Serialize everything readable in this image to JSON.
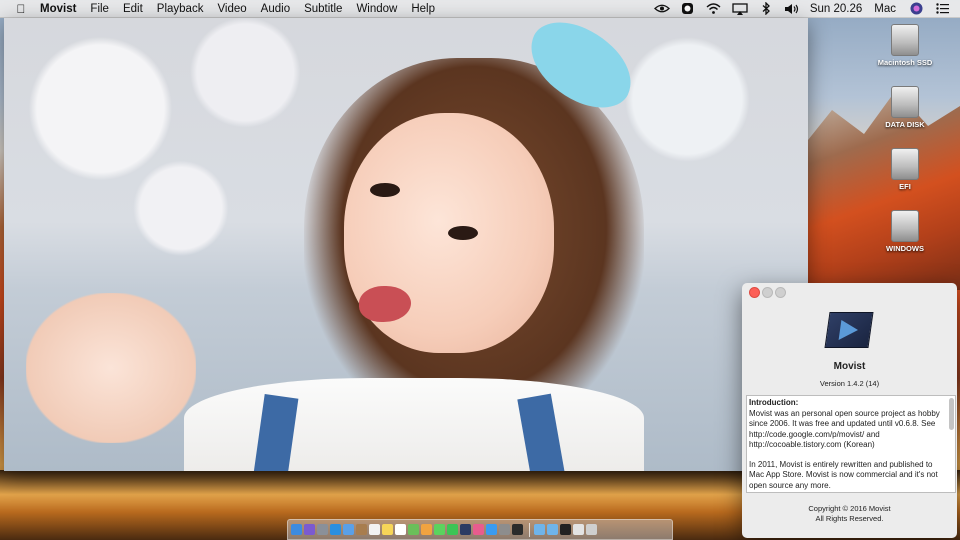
{
  "menubar": {
    "apple_icon": "apple-icon",
    "app_name": "Movist",
    "menus": [
      "File",
      "Edit",
      "Playback",
      "Video",
      "Audio",
      "Subtitle",
      "Window",
      "Help"
    ],
    "status_icons": [
      "nvidia-icon",
      "app-menu-icon",
      "wifi-icon",
      "airplay-icon",
      "bluetooth-icon",
      "volume-icon"
    ],
    "clock": "Sun 20.26",
    "user": "Mac",
    "siri_icon": "siri-icon",
    "notification_icon": "notification-center-icon"
  },
  "desktop": {
    "drives": [
      {
        "label": "Macintosh SSD"
      },
      {
        "label": "DATA DISK"
      },
      {
        "label": "EFI"
      },
      {
        "label": "WINDOWS"
      }
    ]
  },
  "about_window": {
    "title": "Movist",
    "version": "Version 1.4.2 (14)",
    "info_heading": "Introduction:",
    "info_paragraphs": [
      "Movist was an personal open source project as hobby since 2006. It was free and updated until v0.6.8. See http://code.google.com/p/movist/ and http://cocoable.tistory.com (Korean)",
      "In 2011, Movist is entirely rewritten and published to Mac App Store. Movist is now commercial and it's not open source any more."
    ],
    "copyright_line1": "Copyright © 2016 Movist",
    "copyright_line2": "All Rights Reserved."
  },
  "dock": {
    "apps": [
      {
        "name": "finder-icon",
        "color": "#3d8be0"
      },
      {
        "name": "siri-icon",
        "color": "#7b5ad0"
      },
      {
        "name": "launchpad-icon",
        "color": "#8a9099"
      },
      {
        "name": "safari-icon",
        "color": "#2a8fe0"
      },
      {
        "name": "mail-icon",
        "color": "#5aa0e8"
      },
      {
        "name": "contacts-icon",
        "color": "#a87d4e"
      },
      {
        "name": "calendar-icon",
        "color": "#f2f2f2"
      },
      {
        "name": "notes-icon",
        "color": "#f7d558"
      },
      {
        "name": "reminders-icon",
        "color": "#ffffff"
      },
      {
        "name": "maps-icon",
        "color": "#6bbf5a"
      },
      {
        "name": "photos-icon",
        "color": "#f1a340"
      },
      {
        "name": "messages-icon",
        "color": "#5bd35e"
      },
      {
        "name": "facetime-icon",
        "color": "#3cc455"
      },
      {
        "name": "movist-icon",
        "color": "#2c3b63"
      },
      {
        "name": "itunes-icon",
        "color": "#e85c8e"
      },
      {
        "name": "app-store-icon",
        "color": "#3a9bf0"
      },
      {
        "name": "system-preferences-icon",
        "color": "#8d8d8d"
      },
      {
        "name": "video-editor-icon",
        "color": "#2b2b2b"
      },
      {
        "name": "downloads-folder-icon",
        "color": "#6fb4ea"
      },
      {
        "name": "documents-folder-icon",
        "color": "#6fb4ea"
      },
      {
        "name": "terminal-icon",
        "color": "#222222"
      },
      {
        "name": "preview-icon",
        "color": "#e3e3e3"
      },
      {
        "name": "trash-icon",
        "color": "#cfcfcf"
      }
    ]
  }
}
